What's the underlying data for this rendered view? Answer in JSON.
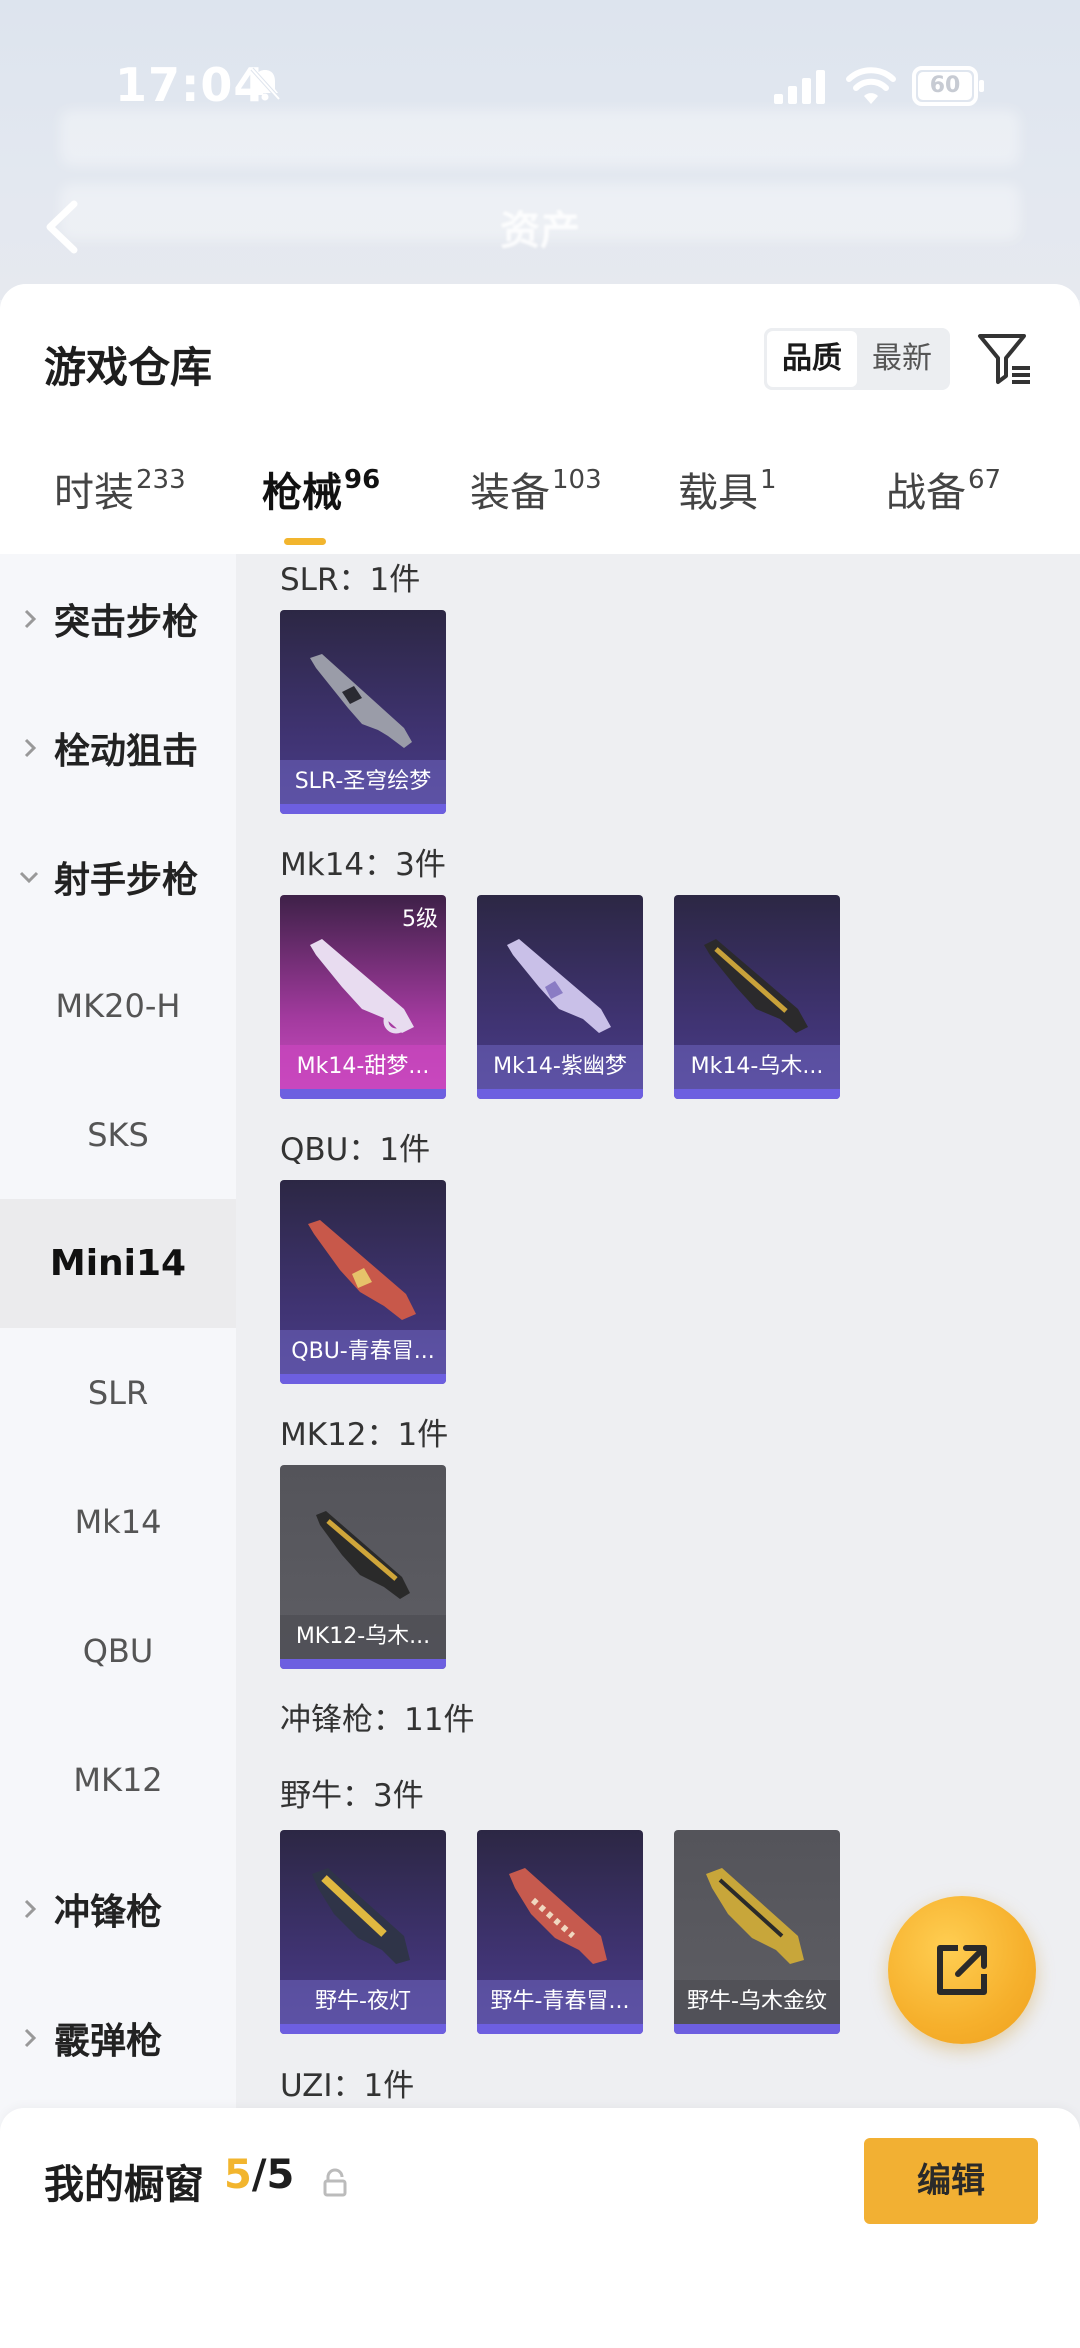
{
  "status_bar": {
    "time": "17:04",
    "battery": "60"
  },
  "header": {
    "title": "资产"
  },
  "sheet": {
    "title": "游戏仓库",
    "sort_options": [
      "品质",
      "最新"
    ],
    "active_sort": "品质"
  },
  "tabs": [
    {
      "label": "时装",
      "count": "233"
    },
    {
      "label": "枪械",
      "count": "96"
    },
    {
      "label": "装备",
      "count": "103"
    },
    {
      "label": "载具",
      "count": "1"
    },
    {
      "label": "战备",
      "count": "67"
    }
  ],
  "side_nav": {
    "assault": "突击步枪",
    "bolt": "栓动狙击",
    "dmr": "射手步枪",
    "mk20": "MK20-H",
    "sks": "SKS",
    "mini14": "Mini14",
    "slr": "SLR",
    "mk14": "Mk14",
    "qbu": "QBU",
    "mk12": "MK12",
    "smg": "冲锋枪",
    "shotgun": "霰弹枪"
  },
  "groups": {
    "slr": {
      "title": "SLR：1件",
      "items": [
        "SLR-圣穹绘梦"
      ]
    },
    "mk14": {
      "title": "Mk14：3件",
      "items": [
        "Mk14-甜梦...",
        "Mk14-紫幽梦",
        "Mk14-乌木..."
      ],
      "level_badge": "5级"
    },
    "qbu": {
      "title": "QBU：1件",
      "items": [
        "QBU-青春冒..."
      ]
    },
    "mk12": {
      "title": "MK12：1件",
      "items": [
        "MK12-乌木..."
      ]
    },
    "smg": {
      "title": "冲锋枪：11件"
    },
    "bizon": {
      "title": "野牛：3件",
      "items": [
        "野牛-夜灯",
        "野牛-青春冒...",
        "野牛-乌木金纹"
      ]
    },
    "uzi": {
      "title": "UZI：1件"
    }
  },
  "showcase": {
    "title": "我的橱窗",
    "used": "5",
    "total": "/5",
    "edit_label": "编辑"
  },
  "colors": {
    "accent": "#f2b52e",
    "card_purple": "#3f3371",
    "card_pink": "#cf50c4",
    "card_gray": "#5e5e64"
  }
}
